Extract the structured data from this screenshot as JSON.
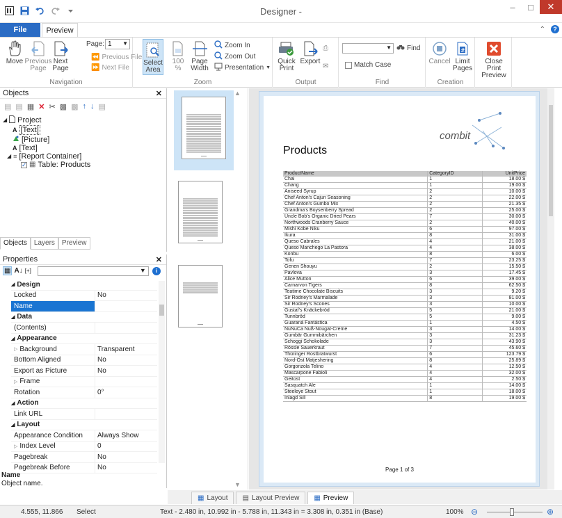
{
  "window": {
    "title": "Designer -"
  },
  "tabs": {
    "file": "File",
    "preview": "Preview"
  },
  "ribbon": {
    "navigation": {
      "label": "Navigation",
      "move": "Move",
      "previous_page": "Previous Page",
      "next_page": "Next Page",
      "page_label": "Page:",
      "page_value": "1",
      "previous_file": "Previous File",
      "next_file": "Next File"
    },
    "zoom": {
      "label": "Zoom",
      "select_area": "Select Area",
      "hundred": "100 %",
      "page_width": "Page Width",
      "zoom_in": "Zoom In",
      "zoom_out": "Zoom Out",
      "presentation": "Presentation"
    },
    "output": {
      "label": "Output",
      "quick_print": "Quick Print",
      "export": "Export"
    },
    "find": {
      "label": "Find",
      "find_button": "Find",
      "match_case": "Match Case",
      "search_value": ""
    },
    "creation": {
      "label": "Creation",
      "cancel": "Cancel",
      "limit_pages": "Limit Pages"
    },
    "close": {
      "label": "Close Print Preview"
    }
  },
  "objects_pane": {
    "title": "Objects",
    "tree": [
      "Project",
      "[Text]",
      "[Picture]",
      "[Text]",
      "[Report Container]",
      "Table: Products"
    ],
    "tabs": [
      "Objects",
      "Layers",
      "Preview"
    ]
  },
  "properties_pane": {
    "title": "Properties",
    "rows": [
      {
        "type": "cat",
        "key": "Design"
      },
      {
        "type": "prop",
        "key": "Locked",
        "value": "No"
      },
      {
        "type": "sel",
        "key": "Name",
        "value": ""
      },
      {
        "type": "cat",
        "key": "Data"
      },
      {
        "type": "prop",
        "key": "(Contents)",
        "value": ""
      },
      {
        "type": "cat",
        "key": "Appearance"
      },
      {
        "type": "expand",
        "key": "Background",
        "value": "Transparent"
      },
      {
        "type": "prop",
        "key": "Bottom Aligned",
        "value": "No"
      },
      {
        "type": "prop",
        "key": "Export as Picture",
        "value": "No"
      },
      {
        "type": "expand",
        "key": "Frame",
        "value": ""
      },
      {
        "type": "prop",
        "key": "Rotation",
        "value": "0°"
      },
      {
        "type": "cat",
        "key": "Action"
      },
      {
        "type": "prop",
        "key": "Link URL",
        "value": ""
      },
      {
        "type": "cat",
        "key": "Layout"
      },
      {
        "type": "prop",
        "key": "Appearance Condition",
        "value": "Always Show"
      },
      {
        "type": "expand",
        "key": "Index Level",
        "value": "0"
      },
      {
        "type": "prop",
        "key": "Pagebreak",
        "value": "No"
      },
      {
        "type": "prop",
        "key": "Pagebreak Before",
        "value": "No"
      }
    ],
    "desc_title": "Name",
    "desc_text": "Object name."
  },
  "report": {
    "heading": "Products",
    "logo_text": "combit",
    "columns": [
      "ProductName",
      "CategoryID",
      "UnitPrice"
    ],
    "rows": [
      [
        "Chai",
        "1",
        "18.00 $"
      ],
      [
        "Chang",
        "1",
        "19.00 $"
      ],
      [
        "Aniseed Syrup",
        "2",
        "10.00 $"
      ],
      [
        "Chef Anton's Cajun Seasoning",
        "2",
        "22.00 $"
      ],
      [
        "Chef Anton's Gumbo Mix",
        "2",
        "21.35 $"
      ],
      [
        "Grandma's Boysenberry Spread",
        "2",
        "25.00 $"
      ],
      [
        "Uncle Bob's Organic Dried Pears",
        "7",
        "30.00 $"
      ],
      [
        "Northwoods Cranberry Sauce",
        "2",
        "40.00 $"
      ],
      [
        "Mishi Kobe Niku",
        "6",
        "97.00 $"
      ],
      [
        "Ikura",
        "8",
        "31.00 $"
      ],
      [
        "Queso Cabrales",
        "4",
        "21.00 $"
      ],
      [
        "Queso Manchego La Pastora",
        "4",
        "38.00 $"
      ],
      [
        "Konbu",
        "8",
        "6.00 $"
      ],
      [
        "Tofu",
        "7",
        "23.25 $"
      ],
      [
        "Genen Shouyu",
        "2",
        "15.50 $"
      ],
      [
        "Pavlova",
        "3",
        "17.45 $"
      ],
      [
        "Alice Mutton",
        "6",
        "39.00 $"
      ],
      [
        "Carnarvon Tigers",
        "8",
        "62.50 $"
      ],
      [
        "Teatime Chocolate Biscuits",
        "3",
        "9.20 $"
      ],
      [
        "Sir Rodney's Marmalade",
        "3",
        "81.00 $"
      ],
      [
        "Sir Rodney's Scones",
        "3",
        "10.00 $"
      ],
      [
        "Gustaf's Knäckebröd",
        "5",
        "21.00 $"
      ],
      [
        "Tunnbröd",
        "5",
        "9.00 $"
      ],
      [
        "Guaraná Fantástica",
        "1",
        "4.50 $"
      ],
      [
        "NuNuCa Nuß-Nougat-Creme",
        "3",
        "14.00 $"
      ],
      [
        "Gumbär Gummibärchen",
        "3",
        "31.23 $"
      ],
      [
        "Schoggi Schokolade",
        "3",
        "43.90 $"
      ],
      [
        "Rössle Sauerkraut",
        "7",
        "45.60 $"
      ],
      [
        "Thüringer Rostbratwurst",
        "6",
        "123.79 $"
      ],
      [
        "Nord-Ost Matjeshering",
        "8",
        "25.89 $"
      ],
      [
        "Gorgonzola Telino",
        "4",
        "12.50 $"
      ],
      [
        "Mascarpone Fabioli",
        "4",
        "32.00 $"
      ],
      [
        "Geitost",
        "4",
        "2.50 $"
      ],
      [
        "Sasquatch Ale",
        "1",
        "14.00 $"
      ],
      [
        "Steeleye Stout",
        "1",
        "18.00 $"
      ],
      [
        "Inlagd Sill",
        "8",
        "19.00 $"
      ]
    ],
    "page_label": "Page 1 of 3"
  },
  "bottom_tabs": [
    "Layout",
    "Layout Preview",
    "Preview"
  ],
  "status": {
    "coords": "4.555, 11.866",
    "mode": "Select",
    "info": "Text - 2.480 in, 10.992 in - 5.788 in, 11.343 in = 3.308 in, 0.351 in (Base)",
    "zoom": "100%"
  }
}
